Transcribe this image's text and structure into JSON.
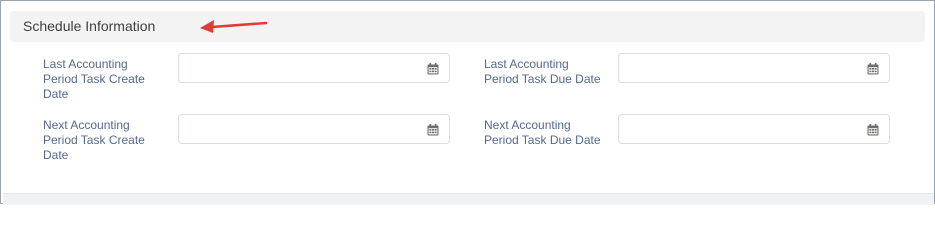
{
  "section": {
    "title": "Schedule Information"
  },
  "fields": [
    {
      "label": "Last Accounting Period Task Create Date",
      "value": ""
    },
    {
      "label": "Last Accounting Period Task Due Date",
      "value": ""
    },
    {
      "label": "Next Accounting Period Task Create Date",
      "value": ""
    },
    {
      "label": "Next Accounting Period Task Due Date",
      "value": ""
    }
  ],
  "icons": {
    "date_picker": "calendar-icon",
    "annotation": "red-arrow-icon"
  },
  "colors": {
    "annotation_arrow": "#e53935",
    "label_text": "#54698d",
    "header_bg": "#f3f3f3"
  }
}
